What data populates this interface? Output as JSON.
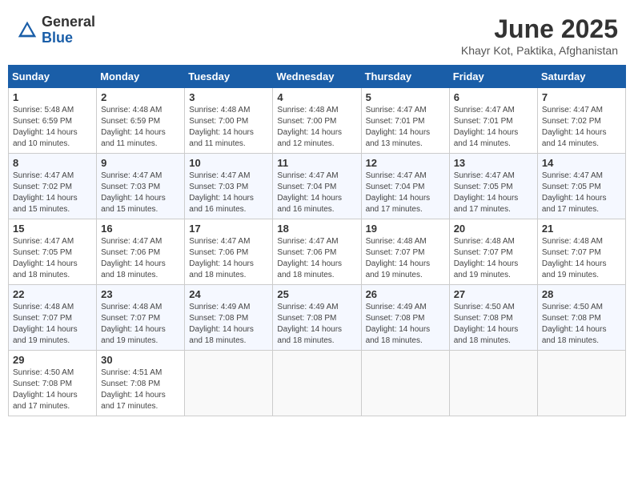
{
  "header": {
    "logo_general": "General",
    "logo_blue": "Blue",
    "month_title": "June 2025",
    "location": "Khayr Kot, Paktika, Afghanistan"
  },
  "days_of_week": [
    "Sunday",
    "Monday",
    "Tuesday",
    "Wednesday",
    "Thursday",
    "Friday",
    "Saturday"
  ],
  "weeks": [
    [
      {
        "day": "1",
        "sunrise": "5:48 AM",
        "sunset": "6:59 PM",
        "daylight": "14 hours and 10 minutes."
      },
      {
        "day": "2",
        "sunrise": "4:48 AM",
        "sunset": "6:59 PM",
        "daylight": "14 hours and 11 minutes."
      },
      {
        "day": "3",
        "sunrise": "4:48 AM",
        "sunset": "7:00 PM",
        "daylight": "14 hours and 11 minutes."
      },
      {
        "day": "4",
        "sunrise": "4:48 AM",
        "sunset": "7:00 PM",
        "daylight": "14 hours and 12 minutes."
      },
      {
        "day": "5",
        "sunrise": "4:47 AM",
        "sunset": "7:01 PM",
        "daylight": "14 hours and 13 minutes."
      },
      {
        "day": "6",
        "sunrise": "4:47 AM",
        "sunset": "7:01 PM",
        "daylight": "14 hours and 14 minutes."
      },
      {
        "day": "7",
        "sunrise": "4:47 AM",
        "sunset": "7:02 PM",
        "daylight": "14 hours and 14 minutes."
      }
    ],
    [
      {
        "day": "8",
        "sunrise": "4:47 AM",
        "sunset": "7:02 PM",
        "daylight": "14 hours and 15 minutes."
      },
      {
        "day": "9",
        "sunrise": "4:47 AM",
        "sunset": "7:03 PM",
        "daylight": "14 hours and 15 minutes."
      },
      {
        "day": "10",
        "sunrise": "4:47 AM",
        "sunset": "7:03 PM",
        "daylight": "14 hours and 16 minutes."
      },
      {
        "day": "11",
        "sunrise": "4:47 AM",
        "sunset": "7:04 PM",
        "daylight": "14 hours and 16 minutes."
      },
      {
        "day": "12",
        "sunrise": "4:47 AM",
        "sunset": "7:04 PM",
        "daylight": "14 hours and 17 minutes."
      },
      {
        "day": "13",
        "sunrise": "4:47 AM",
        "sunset": "7:05 PM",
        "daylight": "14 hours and 17 minutes."
      },
      {
        "day": "14",
        "sunrise": "4:47 AM",
        "sunset": "7:05 PM",
        "daylight": "14 hours and 17 minutes."
      }
    ],
    [
      {
        "day": "15",
        "sunrise": "4:47 AM",
        "sunset": "7:05 PM",
        "daylight": "14 hours and 18 minutes."
      },
      {
        "day": "16",
        "sunrise": "4:47 AM",
        "sunset": "7:06 PM",
        "daylight": "14 hours and 18 minutes."
      },
      {
        "day": "17",
        "sunrise": "4:47 AM",
        "sunset": "7:06 PM",
        "daylight": "14 hours and 18 minutes."
      },
      {
        "day": "18",
        "sunrise": "4:47 AM",
        "sunset": "7:06 PM",
        "daylight": "14 hours and 18 minutes."
      },
      {
        "day": "19",
        "sunrise": "4:48 AM",
        "sunset": "7:07 PM",
        "daylight": "14 hours and 19 minutes."
      },
      {
        "day": "20",
        "sunrise": "4:48 AM",
        "sunset": "7:07 PM",
        "daylight": "14 hours and 19 minutes."
      },
      {
        "day": "21",
        "sunrise": "4:48 AM",
        "sunset": "7:07 PM",
        "daylight": "14 hours and 19 minutes."
      }
    ],
    [
      {
        "day": "22",
        "sunrise": "4:48 AM",
        "sunset": "7:07 PM",
        "daylight": "14 hours and 19 minutes."
      },
      {
        "day": "23",
        "sunrise": "4:48 AM",
        "sunset": "7:07 PM",
        "daylight": "14 hours and 19 minutes."
      },
      {
        "day": "24",
        "sunrise": "4:49 AM",
        "sunset": "7:08 PM",
        "daylight": "14 hours and 18 minutes."
      },
      {
        "day": "25",
        "sunrise": "4:49 AM",
        "sunset": "7:08 PM",
        "daylight": "14 hours and 18 minutes."
      },
      {
        "day": "26",
        "sunrise": "4:49 AM",
        "sunset": "7:08 PM",
        "daylight": "14 hours and 18 minutes."
      },
      {
        "day": "27",
        "sunrise": "4:50 AM",
        "sunset": "7:08 PM",
        "daylight": "14 hours and 18 minutes."
      },
      {
        "day": "28",
        "sunrise": "4:50 AM",
        "sunset": "7:08 PM",
        "daylight": "14 hours and 18 minutes."
      }
    ],
    [
      {
        "day": "29",
        "sunrise": "4:50 AM",
        "sunset": "7:08 PM",
        "daylight": "14 hours and 17 minutes."
      },
      {
        "day": "30",
        "sunrise": "4:51 AM",
        "sunset": "7:08 PM",
        "daylight": "14 hours and 17 minutes."
      },
      null,
      null,
      null,
      null,
      null
    ]
  ]
}
